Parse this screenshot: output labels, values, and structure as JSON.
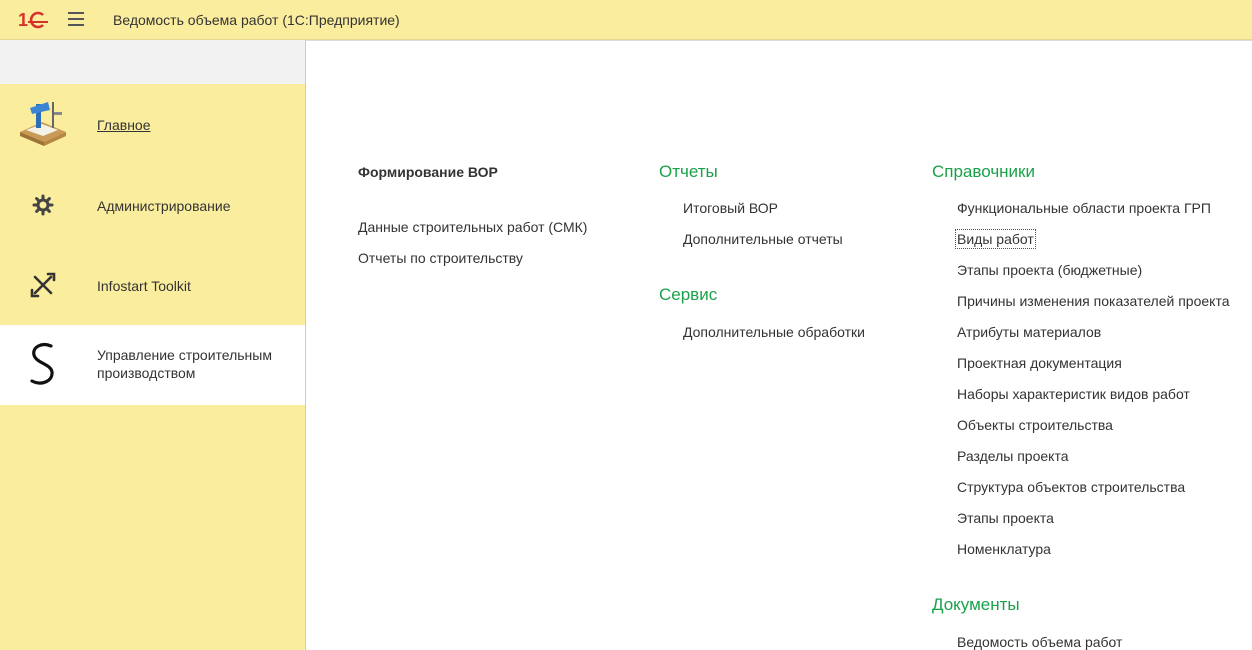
{
  "app": {
    "title": "Ведомость объема работ  (1С:Предприятие)"
  },
  "colors": {
    "accent": "#1aa14a",
    "panel": "#fbed9e",
    "logo_red": "#d6312c"
  },
  "sidebar": {
    "items": [
      {
        "label": "Главное",
        "icon": "desk-lamp-icon",
        "active": false
      },
      {
        "label": "Администрирование",
        "icon": "gear-icon",
        "active": false
      },
      {
        "label": "Infostart Toolkit",
        "icon": "tools-icon",
        "active": false
      },
      {
        "label": "Управление строительным производством",
        "icon": "letter-s-icon",
        "active": true
      }
    ]
  },
  "main": {
    "formation": {
      "heading": "Формирование ВОР",
      "items": [
        "Данные строительных работ (СМК)",
        "Отчеты по строительству"
      ]
    },
    "reports": {
      "title": "Отчеты",
      "items": [
        "Итоговый ВОР",
        "Дополнительные отчеты"
      ]
    },
    "service": {
      "title": "Сервис",
      "items": [
        "Дополнительные обработки"
      ]
    },
    "catalogs": {
      "title": "Справочники",
      "items": [
        "Функциональные области проекта ГРП",
        "Виды работ",
        "Этапы проекта (бюджетные)",
        "Причины изменения показателей проекта",
        "Атрибуты материалов",
        "Проектная документация",
        "Наборы характеристик видов работ",
        "Объекты строительства",
        "Разделы проекта",
        "Структура объектов строительства",
        "Этапы проекта",
        "Номенклатура"
      ]
    },
    "documents": {
      "title": "Документы",
      "items": [
        "Ведомость объема работ"
      ]
    }
  }
}
